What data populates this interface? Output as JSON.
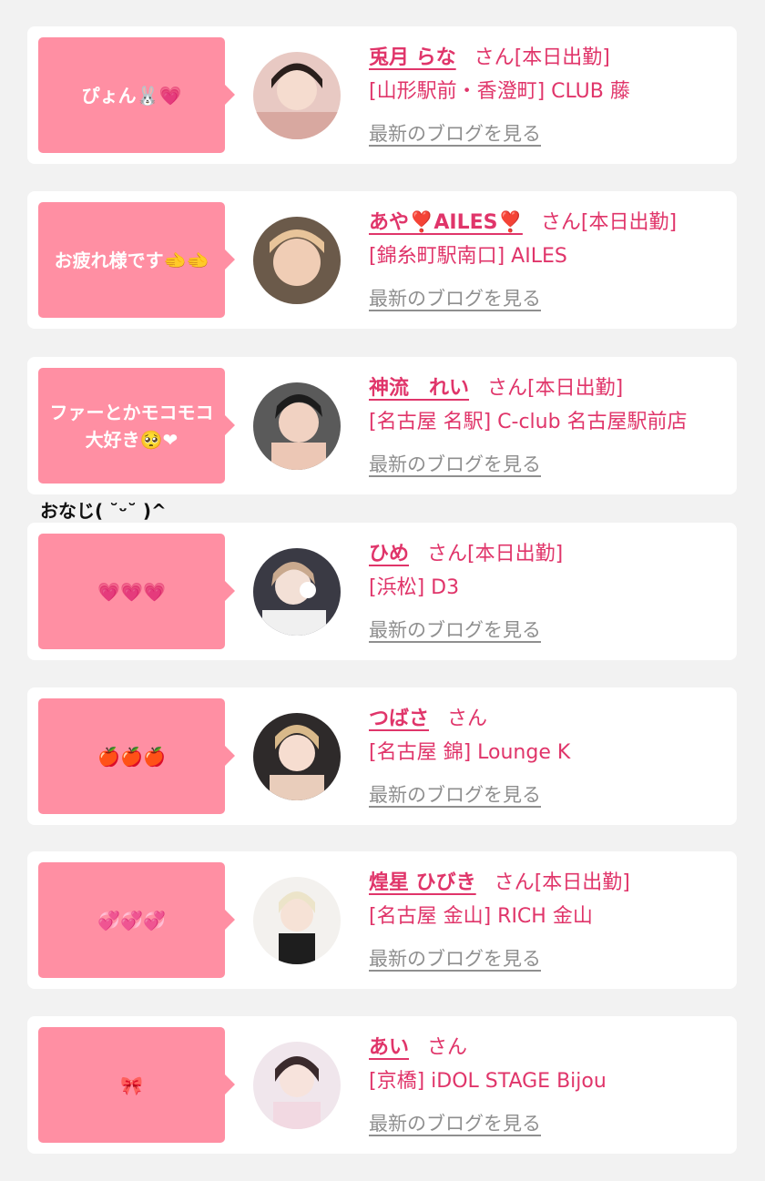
{
  "cards": [
    {
      "bubble": "ぴょん🐰💗",
      "name": "兎月 らな",
      "san": "さん",
      "tag": "[本日出勤]",
      "shop": "[山形駅前・香澄町] CLUB 藤",
      "blog": "最新のブログを見る"
    },
    {
      "bubble": "お疲れ様です🫲🫲",
      "name": "あや❣️AILES❣️",
      "san": "さん",
      "tag": "[本日出勤]",
      "shop": "[錦糸町駅南口] AILES",
      "blog": "最新のブログを見る"
    },
    {
      "bubble": "ファーとかモコモコ大好き🥺❤",
      "name": "神流　れい",
      "san": "さん",
      "tag": "[本日出勤]",
      "shop": "[名古屋 名駅] C-club 名古屋駅前店",
      "blog": "最新のブログを見る"
    },
    {
      "bubble": "💗💗💗",
      "name": "ひめ",
      "san": "さん",
      "tag": "[本日出勤]",
      "shop": "[浜松] D3",
      "blog": "最新のブログを見る"
    },
    {
      "bubble": "🍎🍎🍎",
      "name": "つばさ",
      "san": "さん",
      "tag": "",
      "shop": "[名古屋 錦] Lounge K",
      "blog": "最新のブログを見る"
    },
    {
      "bubble": "💞💞💞",
      "name": "煌星 ひびき",
      "san": "さん",
      "tag": "[本日出勤]",
      "shop": "[名古屋 金山] RICH 金山",
      "blog": "最新のブログを見る"
    },
    {
      "bubble": "🎀",
      "name": "あい",
      "san": "さん",
      "tag": "",
      "shop": "[京橋] iDOL STAGE Bijou",
      "blog": "最新のブログを見る"
    }
  ],
  "overflow_caption": "おなじ( ˘ᵕ˘ )^",
  "colors": {
    "accent": "#e0356a",
    "bubble": "#ff8fa3",
    "link_gray": "#8f8f8f",
    "background": "#f2f2f2"
  }
}
